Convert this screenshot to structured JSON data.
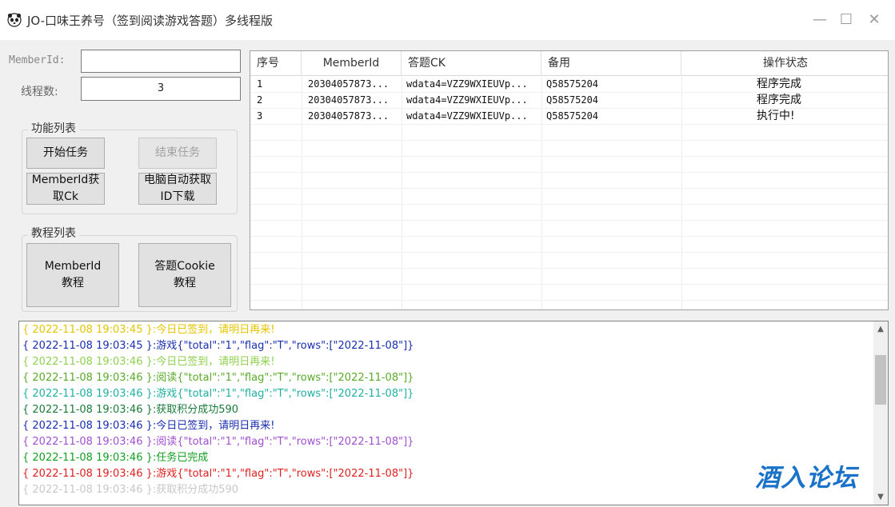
{
  "window": {
    "title": "JO-口味王养号（签到阅读游戏答题）多线程版",
    "controls": {
      "minimize": "—",
      "maximize": "☐",
      "close": "✕"
    }
  },
  "form": {
    "member_label": "MemberId:",
    "member_value": "",
    "threads_label": "线程数:",
    "threads_value": "3"
  },
  "functions": {
    "title": "功能列表",
    "start": "开始任务",
    "stop": "结束任务",
    "member_ck_line1": "MemberId获",
    "member_ck_line2": "取Ck",
    "auto_id_line1": "电脑自动获取",
    "auto_id_line2": "ID下载"
  },
  "tutorials": {
    "title": "教程列表",
    "member_line1": "MemberId",
    "member_line2": "教程",
    "cookie_line1": "答题Cookie",
    "cookie_line2": "教程"
  },
  "grid": {
    "headers": [
      "序号",
      "MemberId",
      "答题CK",
      "备用",
      "操作状态"
    ],
    "rows": [
      {
        "no": "1",
        "member": "20304057873...",
        "ck": "wdata4=VZZ9WXIEUVp...",
        "backup": "Q58575204",
        "status": "程序完成"
      },
      {
        "no": "2",
        "member": "20304057873...",
        "ck": "wdata4=VZZ9WXIEUVp...",
        "backup": "Q58575204",
        "status": "程序完成"
      },
      {
        "no": "3",
        "member": "20304057873...",
        "ck": "wdata4=VZZ9WXIEUVp...",
        "backup": "Q58575204",
        "status": "执行中!"
      }
    ]
  },
  "log": {
    "lines": [
      {
        "text": "{ 2022-11-08 19:03:45 }:今日已签到，请明日再来!",
        "color": "#e6c400"
      },
      {
        "text": "{ 2022-11-08 19:03:45 }:游戏{\"total\":\"1\",\"flag\":\"T\",\"rows\":[\"2022-11-08\"]}",
        "color": "#1a2fb0"
      },
      {
        "text": "{ 2022-11-08 19:03:46 }:今日已签到，请明日再来!",
        "color": "#8fd14f"
      },
      {
        "text": "{ 2022-11-08 19:03:46 }:阅读{\"total\":\"1\",\"flag\":\"T\",\"rows\":[\"2022-11-08\"]}",
        "color": "#5aaa2a"
      },
      {
        "text": "{ 2022-11-08 19:03:46 }:游戏{\"total\":\"1\",\"flag\":\"T\",\"rows\":[\"2022-11-08\"]}",
        "color": "#20b0a0"
      },
      {
        "text": "{ 2022-11-08 19:03:46 }:获取积分成功590",
        "color": "#1a7a3a"
      },
      {
        "text": "{ 2022-11-08 19:03:46 }:今日已签到，请明日再来!",
        "color": "#1a2fb0"
      },
      {
        "text": "{ 2022-11-08 19:03:46 }:阅读{\"total\":\"1\",\"flag\":\"T\",\"rows\":[\"2022-11-08\"]}",
        "color": "#a050d0"
      },
      {
        "text": "{ 2022-11-08 19:03:46 }:任务已完成",
        "color": "#12a020"
      },
      {
        "text": "{ 2022-11-08 19:03:46 }:游戏{\"total\":\"1\",\"flag\":\"T\",\"rows\":[\"2022-11-08\"]}",
        "color": "#e02020"
      },
      {
        "text": "{ 2022-11-08 19:03:46 }:获取积分成功590",
        "color": "#c8c8c8"
      }
    ]
  },
  "watermark": "酒入论坛"
}
